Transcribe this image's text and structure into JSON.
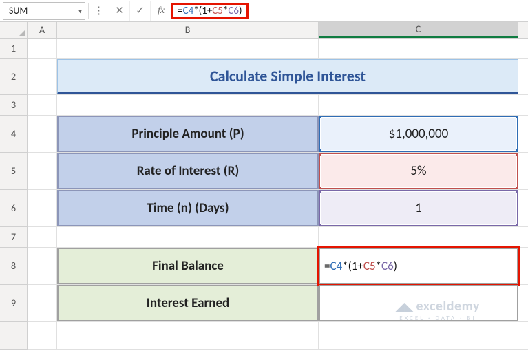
{
  "name_box": "SUM",
  "formula_bar": {
    "fx_label": "fx",
    "eq": "=",
    "ref1": "C4",
    "m1": "*(1+",
    "ref2": "C5",
    "m2": "*",
    "ref3": "C6",
    "m3": ")"
  },
  "col_headers": {
    "A": "A",
    "B": "B",
    "C": "C"
  },
  "row_headers": [
    "1",
    "2",
    "3",
    "4",
    "5",
    "6",
    "7",
    "8",
    "9"
  ],
  "title": "Calculate Simple Interest",
  "labels": {
    "principle": "Principle Amount (P)",
    "rate": "Rate of Interest (R)",
    "time": "Time (n) (Days)",
    "final_balance": "Final Balance",
    "interest_earned": "Interest Earned"
  },
  "values": {
    "principle": "$1,000,000",
    "rate": "5%",
    "time": "1"
  },
  "cell_formula": {
    "eq": "=",
    "ref1": "C4",
    "m1": "*(1+",
    "ref2": "C5",
    "m2": "*",
    "ref3": "C6",
    "m3": ")"
  },
  "watermark": {
    "brand": "exceldemy",
    "tag": "EXCEL · DATA · BI"
  }
}
